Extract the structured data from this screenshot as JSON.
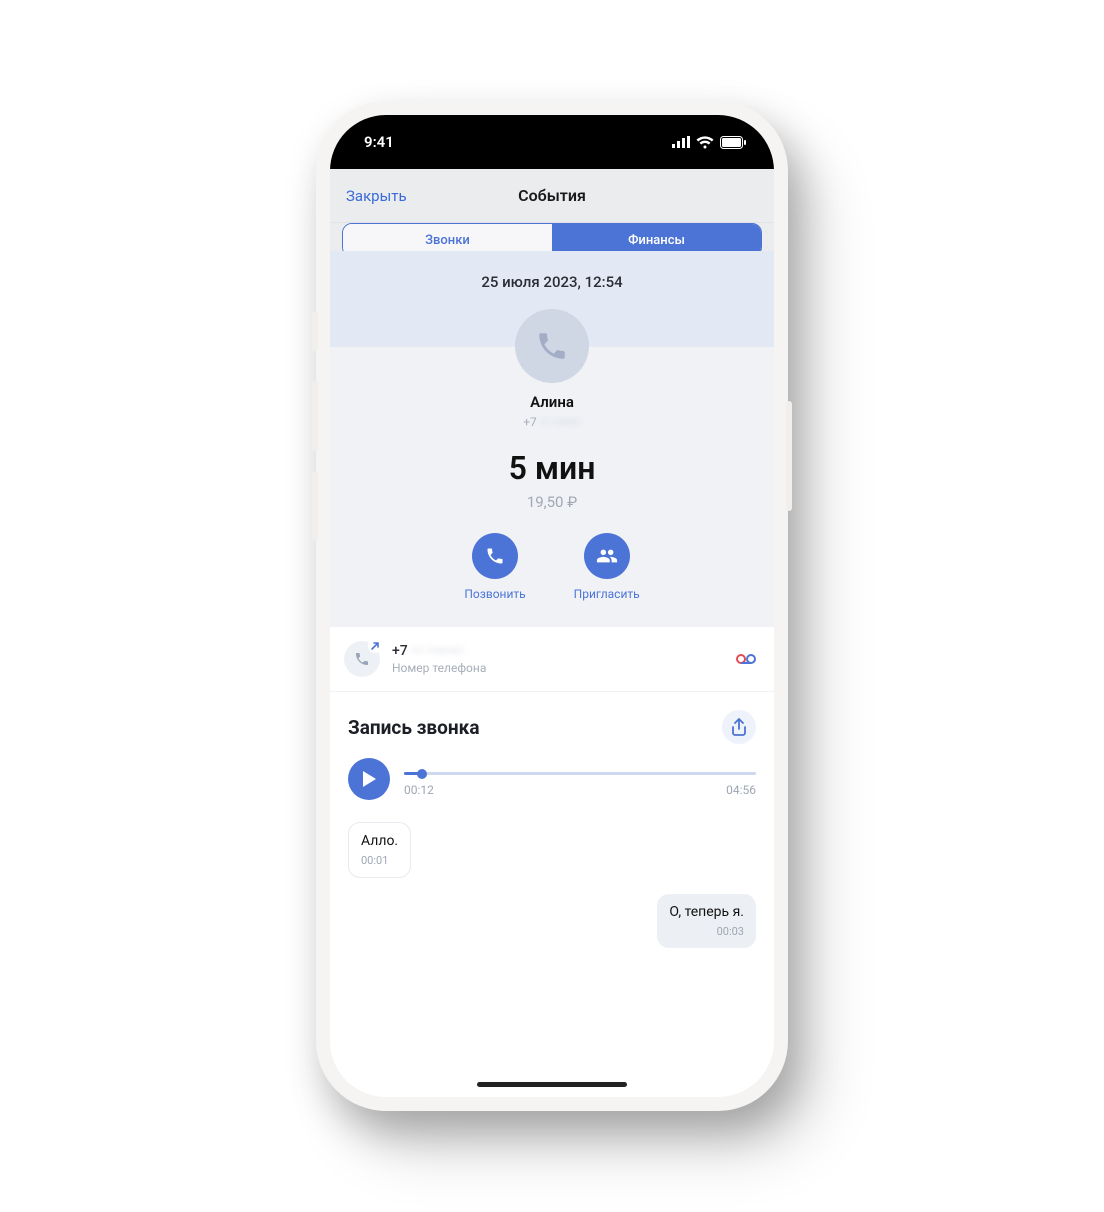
{
  "status": {
    "time": "9:41"
  },
  "header": {
    "close": "Закрыть",
    "title": "События"
  },
  "tabs": {
    "calls": "Звонки",
    "finance": "Финансы"
  },
  "call": {
    "date": "25 июля 2023, 12:54",
    "name": "Алина",
    "phone_prefix": "+7",
    "phone_hidden_mask": "··· ···-··-··",
    "duration": "5 мин",
    "cost": "19,50 ₽"
  },
  "actions": {
    "call": "Позвонить",
    "invite": "Пригласить"
  },
  "number_row": {
    "prefix": "+7",
    "hidden_mask": "··· ···-··-··",
    "sub": "Номер телефона"
  },
  "recording": {
    "title": "Запись звонка",
    "elapsed": "00:12",
    "total": "04:56"
  },
  "transcript": [
    {
      "side": "left",
      "text": "Алло.",
      "time": "00:01"
    },
    {
      "side": "right",
      "text": "О, теперь я.",
      "time": "00:03"
    }
  ]
}
